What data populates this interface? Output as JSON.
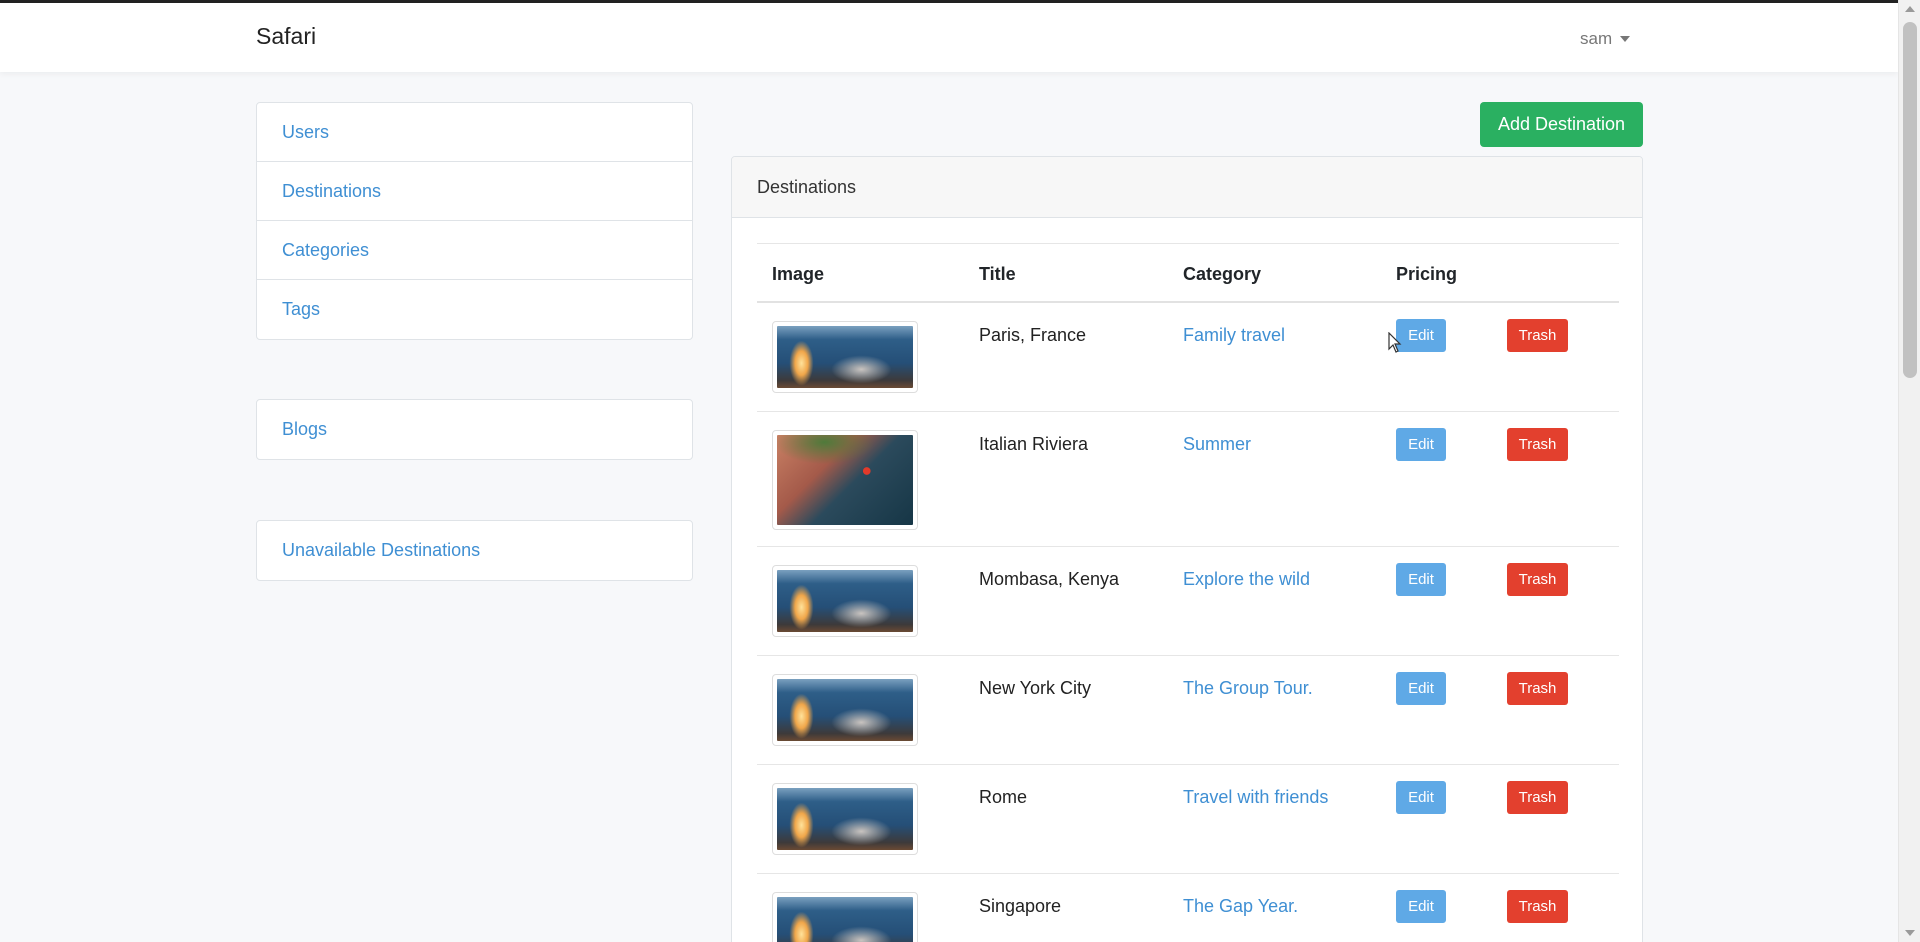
{
  "app": {
    "brand": "Safari",
    "user": "sam"
  },
  "sidebar": {
    "groups": [
      {
        "items": [
          {
            "label": "Users"
          },
          {
            "label": "Destinations"
          },
          {
            "label": "Categories"
          },
          {
            "label": "Tags"
          }
        ]
      },
      {
        "items": [
          {
            "label": "Blogs"
          }
        ]
      },
      {
        "items": [
          {
            "label": "Unavailable Destinations"
          }
        ]
      }
    ]
  },
  "actions": {
    "add_destination": "Add Destination"
  },
  "panel": {
    "title": "Destinations",
    "columns": {
      "image": "Image",
      "title": "Title",
      "category": "Category",
      "pricing": "Pricing"
    },
    "edit_label": "Edit",
    "trash_label": "Trash",
    "rows": [
      {
        "title": "Paris, France",
        "category": "Family travel",
        "image": "lantern-photo"
      },
      {
        "title": "Italian Riviera",
        "category": "Summer",
        "image": "aerial-beach-photo"
      },
      {
        "title": "Mombasa, Kenya",
        "category": "Explore the wild",
        "image": "lantern-photo"
      },
      {
        "title": "New York City",
        "category": "The Group Tour.",
        "image": "lantern-photo"
      },
      {
        "title": "Rome",
        "category": "Travel with friends",
        "image": "lantern-photo"
      },
      {
        "title": "Singapore",
        "category": "The Gap Year.",
        "image": "lantern-photo"
      }
    ]
  },
  "colors": {
    "link": "#3f8fd3",
    "add_button": "#2ab061",
    "edit_button": "#5fa9e6",
    "trash_button": "#e3402e"
  }
}
